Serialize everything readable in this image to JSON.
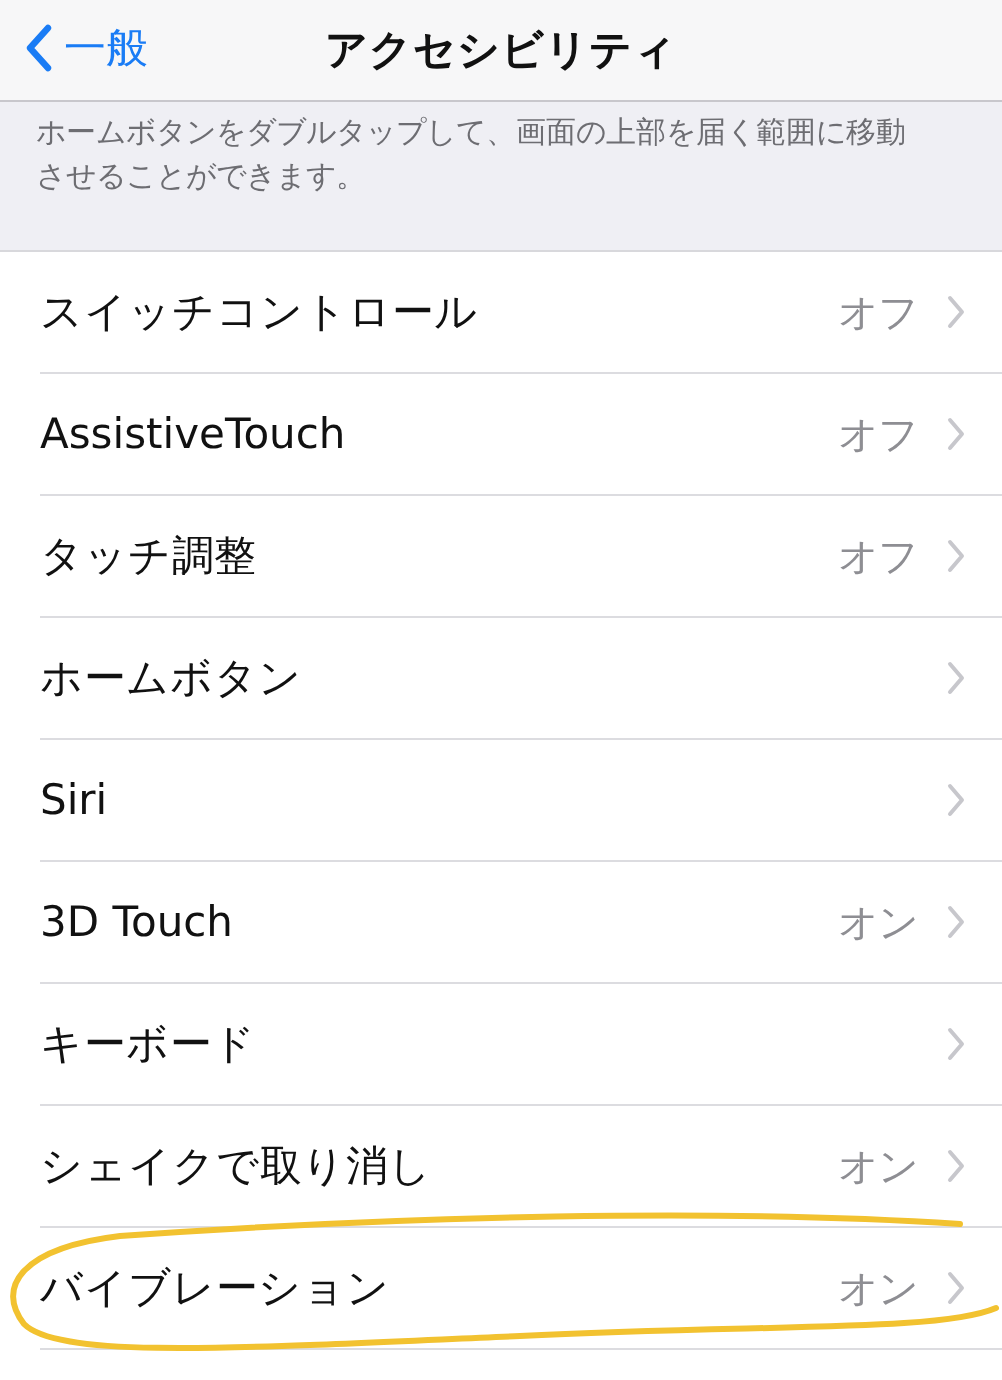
{
  "nav": {
    "back": "一般",
    "title": "アクセシビリティ"
  },
  "description": "ホームボタンをダブルタップして、画面の上部を届く範囲に移動させることができます。",
  "rows": [
    {
      "label": "スイッチコントロール",
      "value": "オフ",
      "highlighted": false
    },
    {
      "label": "AssistiveTouch",
      "value": "オフ",
      "highlighted": false
    },
    {
      "label": "タッチ調整",
      "value": "オフ",
      "highlighted": false
    },
    {
      "label": "ホームボタン",
      "highlighted": false
    },
    {
      "label": "Siri",
      "highlighted": false
    },
    {
      "label": "3D Touch",
      "value": "オン",
      "highlighted": false
    },
    {
      "label": "キーボード",
      "highlighted": false
    },
    {
      "label": "シェイクで取り消し",
      "value": "オン",
      "highlighted": false
    },
    {
      "label": "バイブレーション",
      "value": "オン",
      "highlighted": true
    }
  ]
}
